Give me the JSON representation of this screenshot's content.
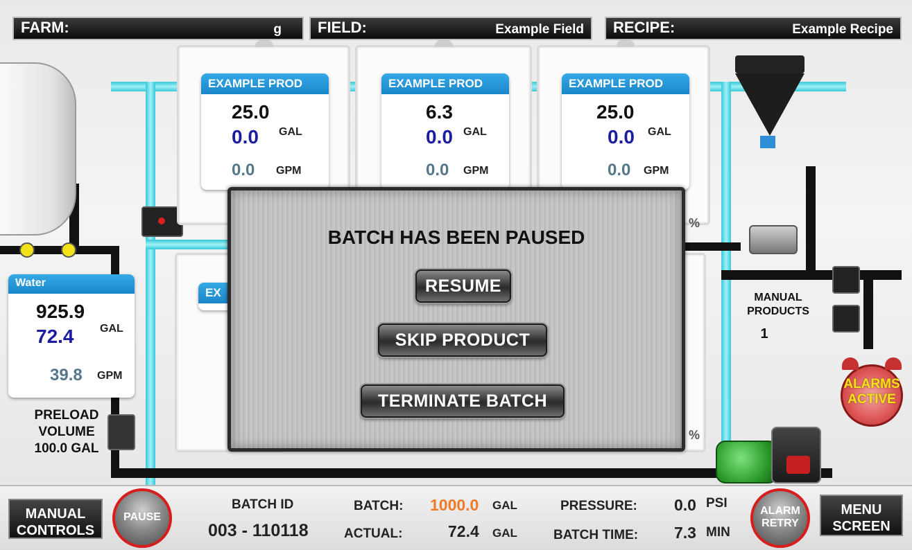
{
  "header": {
    "farm_label": "FARM:",
    "farm_value": "g",
    "field_label": "FIELD:",
    "field_value": "Example Field",
    "recipe_label": "RECIPE:",
    "recipe_value": "Example Recipe"
  },
  "products": [
    {
      "name": "EXAMPLE PROD",
      "target": "25.0",
      "actual": "0.0",
      "unit": "GAL",
      "flow": "0.0",
      "flow_unit": "GPM"
    },
    {
      "name": "EXAMPLE PROD",
      "target": "6.3",
      "actual": "0.0",
      "unit": "GAL",
      "flow": "0.0",
      "flow_unit": "GPM"
    },
    {
      "name": "EXAMPLE PROD",
      "target": "25.0",
      "actual": "0.0",
      "unit": "GAL",
      "flow": "0.0",
      "flow_unit": "GPM"
    }
  ],
  "hidden_prod_partial": "EX",
  "percent_sign": "%",
  "water": {
    "name": "Water",
    "target": "925.9",
    "actual": "72.4",
    "unit": "GAL",
    "flow": "39.8",
    "flow_unit": "GPM"
  },
  "preload": {
    "line1": "PRELOAD",
    "line2": "VOLUME",
    "value": "100.0",
    "unit": "GAL"
  },
  "manual_products": {
    "line1": "MANUAL",
    "line2": "PRODUCTS",
    "count": "1"
  },
  "alarm_indicator": {
    "line1": "ALARMS",
    "line2": "ACTIVE",
    "color": "#f5e21c"
  },
  "modal": {
    "title": "BATCH HAS BEEN PAUSED",
    "resume": "RESUME",
    "skip": "SKIP PRODUCT",
    "terminate": "TERMINATE BATCH"
  },
  "footer": {
    "manual_controls_1": "MANUAL",
    "manual_controls_2": "CONTROLS",
    "pause": "PAUSE",
    "batch_id_label": "BATCH ID",
    "batch_id_value": "003 - 110118",
    "batch_label": "BATCH:",
    "batch_value": "1000.0",
    "batch_unit": "GAL",
    "actual_label": "ACTUAL:",
    "actual_value": "72.4",
    "actual_unit": "GAL",
    "pressure_label": "PRESSURE:",
    "pressure_value": "0.0",
    "pressure_unit": "PSI",
    "batch_time_label": "BATCH TIME:",
    "batch_time_value": "7.3",
    "batch_time_unit": "MIN",
    "alarm_retry_1": "ALARM",
    "alarm_retry_2": "RETRY",
    "menu_screen_1": "MENU",
    "menu_screen_2": "SCREEN"
  },
  "colors": {
    "product_header": "#1a86c9",
    "actual_blue": "#1c1ca0",
    "flow_gray": "#55778a",
    "batch_orange": "#f07a28",
    "alarm_ring": "#d81d1d",
    "pipe_cyan": "#38c9d8"
  }
}
